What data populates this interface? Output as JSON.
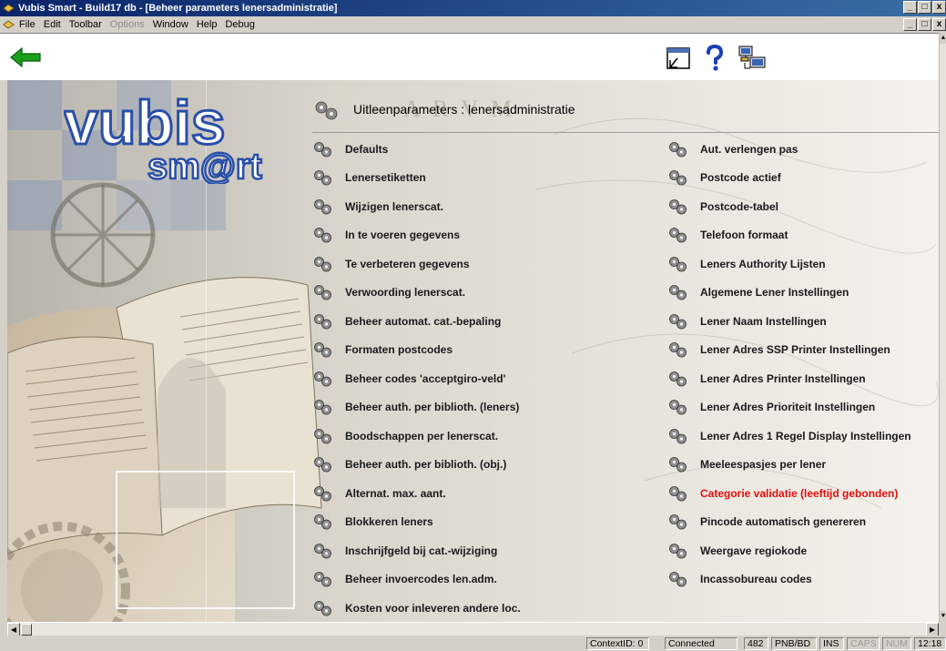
{
  "window": {
    "title": "Vubis Smart - Build17 db - [Beheer parameters lenersadministratie]"
  },
  "menu": [
    {
      "label": "File",
      "disabled": false
    },
    {
      "label": "Edit",
      "disabled": false
    },
    {
      "label": "Toolbar",
      "disabled": false
    },
    {
      "label": "Options",
      "disabled": true
    },
    {
      "label": "Window",
      "disabled": false
    },
    {
      "label": "Help",
      "disabled": false
    },
    {
      "label": "Debug",
      "disabled": false
    }
  ],
  "logo": {
    "line1": "vubis",
    "line2": "sm@rt"
  },
  "page": {
    "heading": "Uitleenparameters : lenersadministratie"
  },
  "links_left": [
    "Defaults",
    "Lenersetiketten",
    "Wijzigen lenerscat.",
    "In te voeren gegevens",
    "Te verbeteren gegevens",
    "Verwoording lenerscat.",
    "Beheer automat. cat.-bepaling",
    "Formaten postcodes",
    "Beheer codes 'acceptgiro-veld'",
    "Beheer auth. per biblioth. (leners)",
    "Boodschappen per lenerscat.",
    "Beheer auth. per biblioth. (obj.)",
    "Alternat. max. aant.",
    "Blokkeren leners",
    "Inschrijfgeld bij cat.-wijziging",
    "Beheer invoercodes len.adm.",
    "Kosten voor inleveren andere loc."
  ],
  "links_right": [
    "Aut. verlengen pas",
    "Postcode actief",
    "Postcode-tabel",
    "Telefoon formaat",
    "Leners Authority Lijsten",
    "Algemene Lener Instellingen",
    "Lener Naam Instellingen",
    "Lener Adres SSP Printer Instellingen",
    "Lener Adres Printer Instellingen",
    "Lener Adres Prioriteit Instellingen",
    "Lener Adres 1 Regel Display Instellingen",
    "Meeleespasjes per lener",
    "Categorie validatie (leeftijd gebonden)",
    "Pincode automatisch genereren",
    "Weergave regiokode",
    "Incassobureau codes"
  ],
  "highlighted_right_index": 12,
  "status": {
    "context": "ContextID: 0",
    "connection": "Connected",
    "count": "482",
    "location": "PNB/BD",
    "ins": "INS",
    "caps": "CAPS",
    "num": "NUM",
    "time": "12:18"
  },
  "colors": {
    "highlight": "#e01010",
    "back_arrow": "#1aa11a",
    "title_bar": "#0a246a"
  },
  "icons": {
    "back": "green-left-arrow-icon",
    "gear": "gear-icon",
    "help": "question-mark-icon",
    "window": "window-icon",
    "network": "network-computer-icon"
  }
}
